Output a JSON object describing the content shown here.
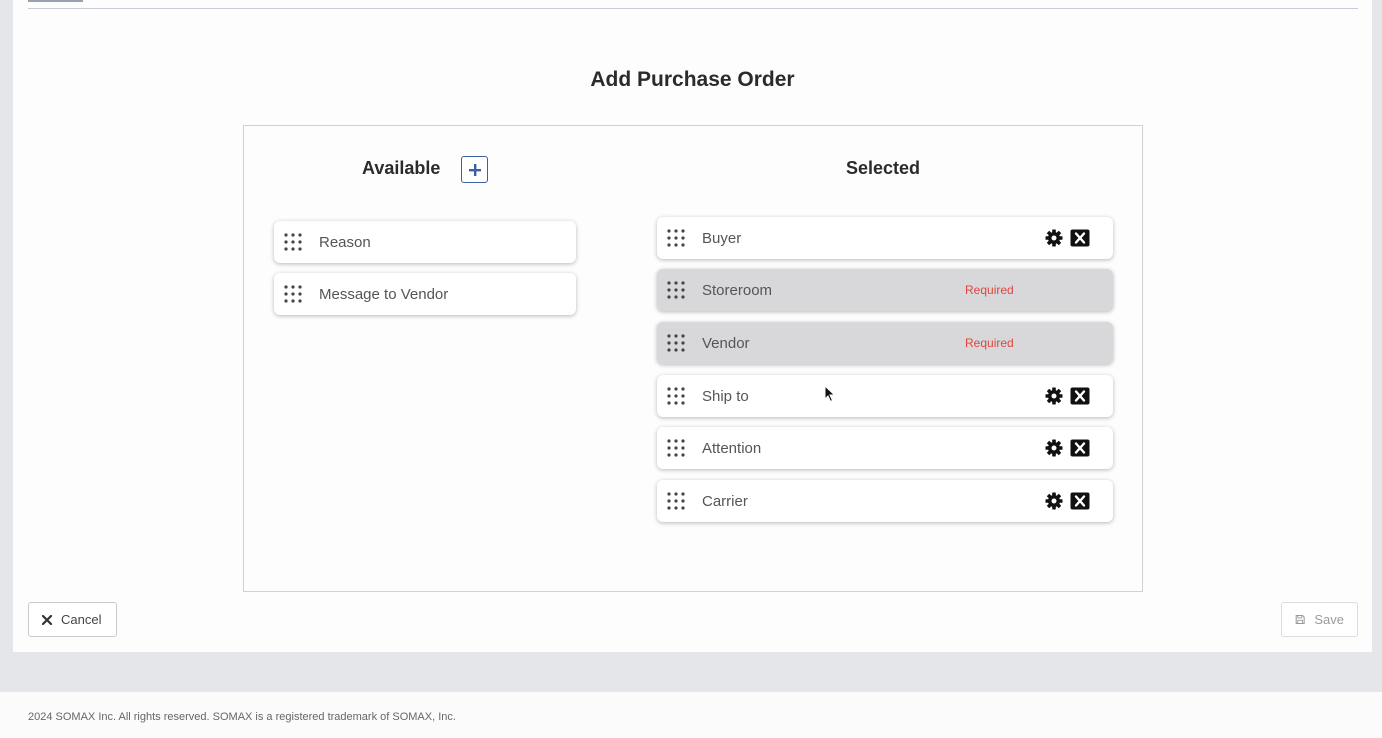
{
  "page": {
    "title": "Add Purchase Order"
  },
  "available": {
    "heading": "Available",
    "add_icon": "plus-icon",
    "items": [
      {
        "label": "Reason"
      },
      {
        "label": "Message to Vendor"
      }
    ]
  },
  "selected": {
    "heading": "Selected",
    "items": [
      {
        "label": "Buyer",
        "required": false
      },
      {
        "label": "Storeroom",
        "required": true,
        "required_text": "Required"
      },
      {
        "label": "Vendor",
        "required": true,
        "required_text": "Required"
      },
      {
        "label": "Ship to",
        "required": false
      },
      {
        "label": "Attention",
        "required": false
      },
      {
        "label": "Carrier",
        "required": false
      }
    ]
  },
  "actions": {
    "cancel_label": "Cancel",
    "save_label": "Save"
  },
  "footer": {
    "text": "2024 SOMAX Inc. All rights reserved. SOMAX is a registered trademark of SOMAX, Inc."
  },
  "colors": {
    "accent": "#3b5fa0",
    "required": "#e0453c",
    "required_row_bg": "#d8d8da"
  }
}
